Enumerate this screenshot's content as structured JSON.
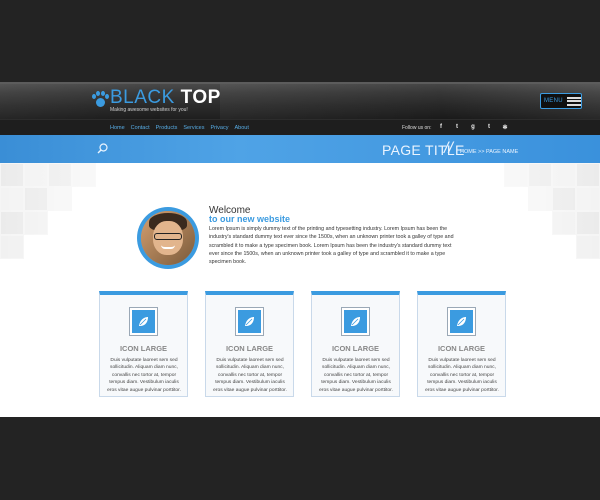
{
  "brand": {
    "logo_part1": "BLACK",
    "logo_part2": "TOP",
    "tagline": "Making awesome websites for you!",
    "accent_color": "#3b9be0"
  },
  "header": {
    "menu_label": "MENU"
  },
  "nav": {
    "links": [
      "Home",
      "Contact",
      "Products",
      "Services",
      "Privacy",
      "About"
    ],
    "follow_label": "Follow us on:",
    "socials": [
      {
        "icon": "facebook-icon",
        "glyph": "f"
      },
      {
        "icon": "twitter-icon",
        "glyph": "t"
      },
      {
        "icon": "google-plus-icon",
        "glyph": "g"
      },
      {
        "icon": "tumblr-icon",
        "glyph": "t"
      },
      {
        "icon": "yelp-icon",
        "glyph": "✻"
      }
    ]
  },
  "titlebar": {
    "page_title": "PAGE TITLE",
    "separator": "//",
    "breadcrumb": "HOME >> PAGE NAME"
  },
  "intro": {
    "welcome": "Welcome",
    "subtitle": "to our new website",
    "body": "Lorem Ipsum is simply dummy text of the printing and typesetting industry. Lorem Ipsum has been the industry's standard dummy text ever since the 1500s, when an unknown printer took a galley of type and scrambled it to make a type specimen book. Lorem Ipsum has been the industry's standard dummy text ever since the 1500s, when an unknown printer took a galley of type and scrambled it to make a type specimen book."
  },
  "cards": [
    {
      "title": "ICON LARGE",
      "text": "Duis vulputate laoreet sem sed sollicitudin. Aliquam diam nunc, convallis nec tortor at, tempor tempus diam. Vestibulum iaculis eros vitae augue pulvinar porttitor."
    },
    {
      "title": "ICON LARGE",
      "text": "Duis vulputate laoreet sem sed sollicitudin. Aliquam diam nunc, convallis nec tortor at, tempor tempus diam. Vestibulum iaculis eros vitae augue pulvinar porttitor."
    },
    {
      "title": "ICON LARGE",
      "text": "Duis vulputate laoreet sem sed sollicitudin. Aliquam diam nunc, convallis nec tortor at, tempor tempus diam. Vestibulum iaculis eros vitae augue pulvinar porttitor."
    },
    {
      "title": "ICON LARGE",
      "text": "Duis vulputate laoreet sem sed sollicitudin. Aliquam diam nunc, convallis nec tortor at, tempor tempus diam. Vestibulum iaculis eros vitae augue pulvinar porttitor."
    }
  ]
}
